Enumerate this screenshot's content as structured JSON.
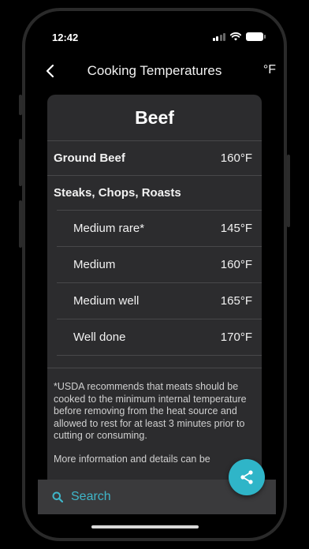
{
  "status": {
    "time": "12:42"
  },
  "nav": {
    "title": "Cooking Temperatures",
    "unit_label": "°F"
  },
  "card": {
    "title": "Beef",
    "rows": [
      {
        "label": "Ground Beef",
        "value": "160°F"
      }
    ],
    "section_label": "Steaks, Chops, Roasts",
    "sub_rows": [
      {
        "label": "Medium rare*",
        "value": "145°F"
      },
      {
        "label": "Medium",
        "value": "160°F"
      },
      {
        "label": "Medium well",
        "value": "165°F"
      },
      {
        "label": "Well done",
        "value": "170°F"
      }
    ],
    "note": "*USDA recommends that meats should be cooked to the minimum internal temperature before removing from the heat source and allowed to rest for at least 3 minutes prior to cutting or consuming.",
    "more_info": "More information and details can be"
  },
  "search": {
    "label": "Search"
  },
  "colors": {
    "accent": "#2fb5c8",
    "card_bg": "#2c2c2e",
    "background": "#000000"
  },
  "icons": {
    "back": "chevron-left-icon",
    "share": "share-icon",
    "search": "search-icon"
  }
}
